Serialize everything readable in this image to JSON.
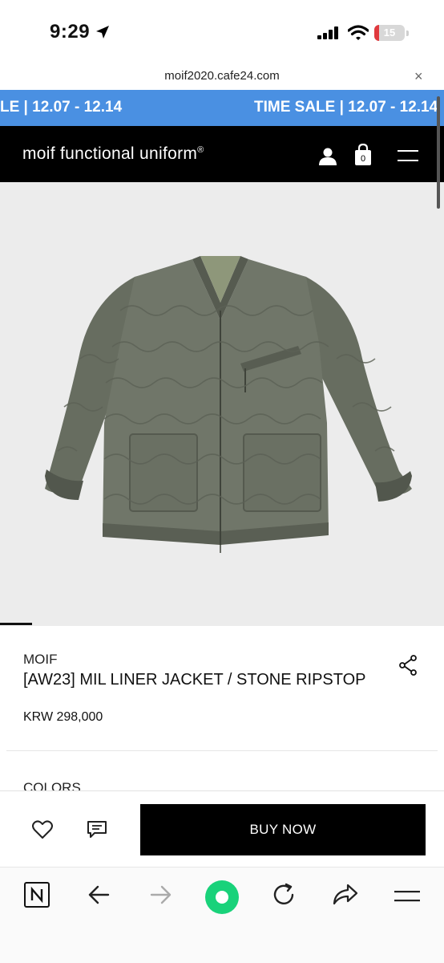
{
  "status_bar": {
    "time": "9:29",
    "battery": "15",
    "battery_level": 0.15
  },
  "browser": {
    "url": "moif2020.cafe24.com",
    "close_glyph": "×"
  },
  "banner": {
    "sale_text_partial": "LE | 12.07 - 12.14",
    "sale_text": "TIME SALE | 12.07 - 12.14"
  },
  "header": {
    "logo": "moif functional uniform",
    "logo_mark": "®",
    "cart_count": "0"
  },
  "product": {
    "brand": "MOIF",
    "name": "[AW23] MIL LINER JACKET / STONE RIPSTOP",
    "price": "KRW 298,000",
    "colors_label": "COLORS"
  },
  "action_bar": {
    "buy_label": "BUY NOW"
  },
  "icons": {
    "user": "user-icon",
    "bag": "shopping-bag-icon",
    "menu": "hamburger-menu-icon",
    "share": "share-icon",
    "wish": "heart-icon",
    "review": "chat-icon",
    "browser_home": "naver-n-icon",
    "back": "arrow-left-icon",
    "forward": "arrow-right-icon",
    "green_dot": "green-dot-icon",
    "reload": "reload-icon",
    "share_browser": "forward-share-icon",
    "browser_menu": "hamburger-menu-icon"
  },
  "colors": {
    "banner": "#4a90e2",
    "header": "#000000",
    "buy_button": "#000000",
    "battery_fill": "#e0393e",
    "green_dot": "#19d27a",
    "image_bg": "#ececec",
    "jacket": "#6f7568"
  }
}
